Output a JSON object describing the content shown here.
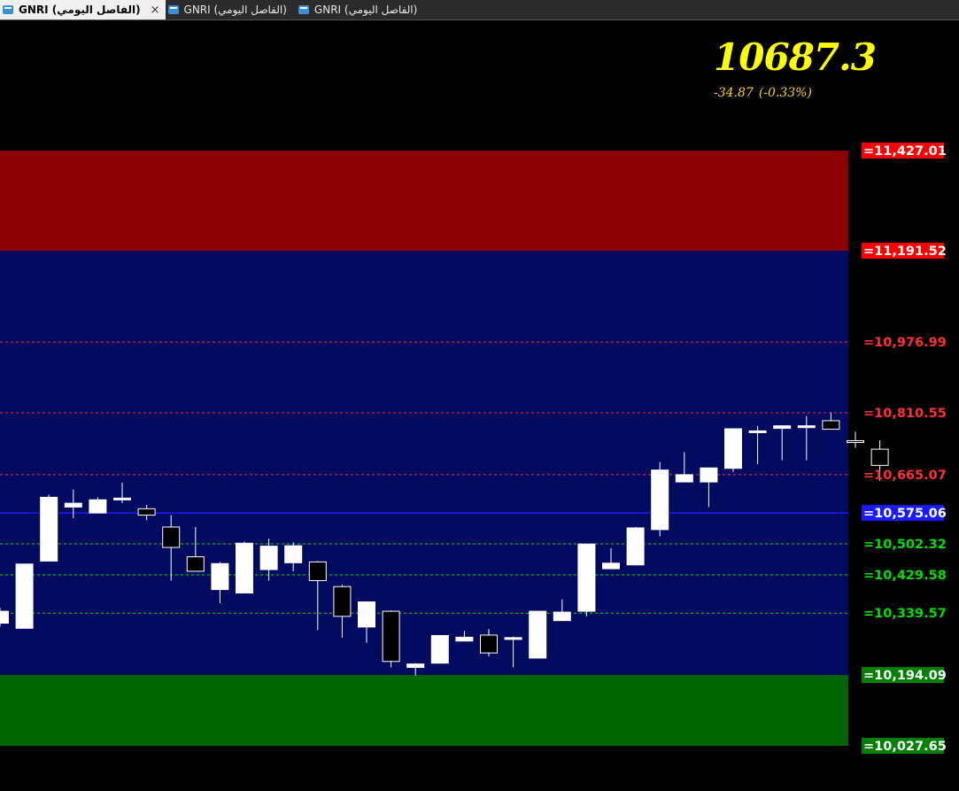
{
  "tabs": [
    {
      "label": "GNRI (الفاصل اليومي)",
      "active": true,
      "close": "×"
    },
    {
      "label": "GNRI (الفاصل اليومي)",
      "active": false
    },
    {
      "label": "GNRI (الفاصل اليومي)",
      "active": false
    }
  ],
  "price_display": {
    "last": "10687.3",
    "change": "-34.87",
    "change_pct": "(-0.33%)"
  },
  "colors": {
    "background": "#000000",
    "resistance_zone": "#8b0000",
    "middle_zone": "#000a5e",
    "support_zone": "#006400",
    "last_price_text": "#ffff00",
    "up_candle": "#ffffff",
    "down_candle": "#000000"
  },
  "chart_data": {
    "type": "candlestick",
    "title": "",
    "y_axis": {
      "scale": "linear",
      "position": "right"
    },
    "zones": [
      {
        "name": "upper-zone",
        "from": 11191.52,
        "to": 11427.01,
        "color": "#8b0000"
      },
      {
        "name": "middle-zone",
        "from": 10194.09,
        "to": 11191.52,
        "color": "#000a5e"
      },
      {
        "name": "lower-zone",
        "from": 10027.65,
        "to": 10194.09,
        "color": "#006400"
      }
    ],
    "levels": [
      {
        "value": 11427.01,
        "label": "=11,427.01",
        "style": "boxed",
        "color": "#ff0000",
        "line": "none"
      },
      {
        "value": 11191.52,
        "label": "=11,191.52",
        "style": "boxed",
        "color": "#ff0000",
        "line": "none"
      },
      {
        "value": 10976.99,
        "label": "=10,976.99",
        "style": "text",
        "color": "#ff3030",
        "line": "dashed"
      },
      {
        "value": 10810.55,
        "label": "=10,810.55",
        "style": "text",
        "color": "#ff3030",
        "line": "dashed"
      },
      {
        "value": 10665.07,
        "label": "=10,665.07",
        "style": "text",
        "color": "#ff3030",
        "line": "dashed"
      },
      {
        "value": 10575.06,
        "label": "=10,575.06",
        "style": "boxed",
        "color": "#1a1aff",
        "line": "solid"
      },
      {
        "value": 10502.32,
        "label": "=10,502.32",
        "style": "text",
        "color": "#00e000",
        "line": "dashed"
      },
      {
        "value": 10429.58,
        "label": "=10,429.58",
        "style": "text",
        "color": "#00e000",
        "line": "dashed"
      },
      {
        "value": 10339.57,
        "label": "=10,339.57",
        "style": "text",
        "color": "#00e000",
        "line": "dashed"
      },
      {
        "value": 10194.09,
        "label": "=10,194.09",
        "style": "boxed",
        "color": "#008000",
        "line": "none"
      },
      {
        "value": 10027.65,
        "label": "=10,027.65",
        "style": "boxed",
        "color": "#008000",
        "line": "none"
      }
    ],
    "candles": [
      {
        "o": 10316,
        "h": 10352,
        "l": 10308,
        "c": 10344
      },
      {
        "o": 10304,
        "h": 10455,
        "l": 10304,
        "c": 10455
      },
      {
        "o": 10462,
        "h": 10618,
        "l": 10462,
        "c": 10612
      },
      {
        "o": 10589,
        "h": 10630,
        "l": 10563,
        "c": 10598
      },
      {
        "o": 10575,
        "h": 10612,
        "l": 10575,
        "c": 10606
      },
      {
        "o": 10608,
        "h": 10646,
        "l": 10598,
        "c": 10610
      },
      {
        "o": 10585,
        "h": 10594,
        "l": 10558,
        "c": 10570
      },
      {
        "o": 10542,
        "h": 10570,
        "l": 10416,
        "c": 10494
      },
      {
        "o": 10472,
        "h": 10542,
        "l": 10438,
        "c": 10438
      },
      {
        "o": 10395,
        "h": 10460,
        "l": 10363,
        "c": 10456
      },
      {
        "o": 10387,
        "h": 10508,
        "l": 10387,
        "c": 10504
      },
      {
        "o": 10442,
        "h": 10515,
        "l": 10416,
        "c": 10497
      },
      {
        "o": 10458,
        "h": 10506,
        "l": 10438,
        "c": 10498
      },
      {
        "o": 10460,
        "h": 10462,
        "l": 10300,
        "c": 10416
      },
      {
        "o": 10402,
        "h": 10406,
        "l": 10282,
        "c": 10332
      },
      {
        "o": 10307,
        "h": 10366,
        "l": 10270,
        "c": 10366
      },
      {
        "o": 10344,
        "h": 10346,
        "l": 10212,
        "c": 10226
      },
      {
        "o": 10212,
        "h": 10222,
        "l": 10193,
        "c": 10220
      },
      {
        "o": 10222,
        "h": 10287,
        "l": 10222,
        "c": 10287
      },
      {
        "o": 10274,
        "h": 10298,
        "l": 10274,
        "c": 10283
      },
      {
        "o": 10288,
        "h": 10302,
        "l": 10238,
        "c": 10246
      },
      {
        "o": 10279,
        "h": 10284,
        "l": 10212,
        "c": 10282
      },
      {
        "o": 10234,
        "h": 10344,
        "l": 10234,
        "c": 10344
      },
      {
        "o": 10322,
        "h": 10372,
        "l": 10322,
        "c": 10342
      },
      {
        "o": 10344,
        "h": 10502,
        "l": 10332,
        "c": 10502
      },
      {
        "o": 10444,
        "h": 10492,
        "l": 10444,
        "c": 10457
      },
      {
        "o": 10453,
        "h": 10542,
        "l": 10453,
        "c": 10540
      },
      {
        "o": 10536,
        "h": 10695,
        "l": 10520,
        "c": 10676
      },
      {
        "o": 10648,
        "h": 10718,
        "l": 10648,
        "c": 10665
      },
      {
        "o": 10648,
        "h": 10681,
        "l": 10589,
        "c": 10681
      },
      {
        "o": 10680,
        "h": 10774,
        "l": 10672,
        "c": 10773
      },
      {
        "o": 10768,
        "h": 10780,
        "l": 10690,
        "c": 10768
      },
      {
        "o": 10774,
        "h": 10780,
        "l": 10699,
        "c": 10780
      },
      {
        "o": 10780,
        "h": 10803,
        "l": 10699,
        "c": 10780
      },
      {
        "o": 10792,
        "h": 10811,
        "l": 10773,
        "c": 10772
      },
      {
        "o": 10745,
        "h": 10766,
        "l": 10728,
        "c": 10741
      },
      {
        "o": 10725,
        "h": 10746,
        "l": 10651,
        "c": 10687
      }
    ]
  }
}
